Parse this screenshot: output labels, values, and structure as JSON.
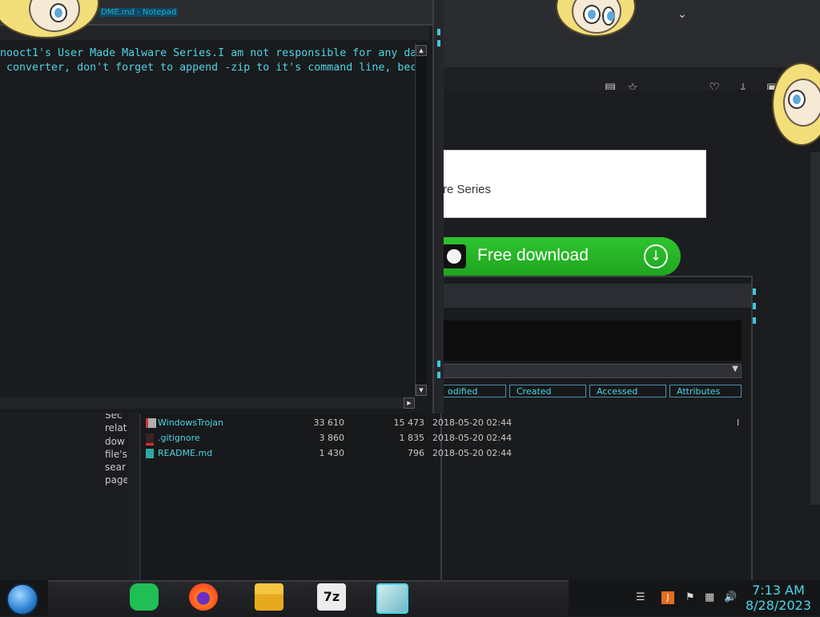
{
  "browser": {
    "card_text": "re Series",
    "download_label": "Free download",
    "icons": [
      "chevron-down-icon",
      "reader-view-icon",
      "bookmark-star-icon",
      "pocket-icon",
      "downloads-icon",
      "extensions-icon",
      "menu-icon"
    ]
  },
  "notepad": {
    "title": "DME.md - Notepad",
    "lines": [
      "nooct1's User Made Malware Series.I am not responsible for any da",
      " converter, don't forget to append -zip to it's command line, bec"
    ]
  },
  "explorer": {
    "columns": [
      "odified",
      "Created",
      "Accessed",
      "Attributes"
    ],
    "left_text": [
      "Sec",
      "relat",
      "dow",
      "file's",
      "sear",
      "page"
    ],
    "files": [
      {
        "name": "WindowsTrojan",
        "size": "33 610",
        "packed": "15 473",
        "modified": "2018-05-20 02:44",
        "mark": "I"
      },
      {
        "name": ".gitignore",
        "size": "3 860",
        "packed": "1 835",
        "modified": "2018-05-20 02:44",
        "mark": ""
      },
      {
        "name": "README.md",
        "size": "1 430",
        "packed": "796",
        "modified": "2018-05-20 02:44",
        "mark": ""
      }
    ]
  },
  "taskbar": {
    "apps": [
      "start-orb",
      "notes-app",
      "firefox",
      "file-explorer",
      "7zip",
      "notepad"
    ],
    "time": "7:13 AM",
    "date": "8/28/2023",
    "tray_icons": [
      "show-hidden-icon",
      "java-icon",
      "flag-icon",
      "network-icon",
      "volume-icon"
    ]
  }
}
